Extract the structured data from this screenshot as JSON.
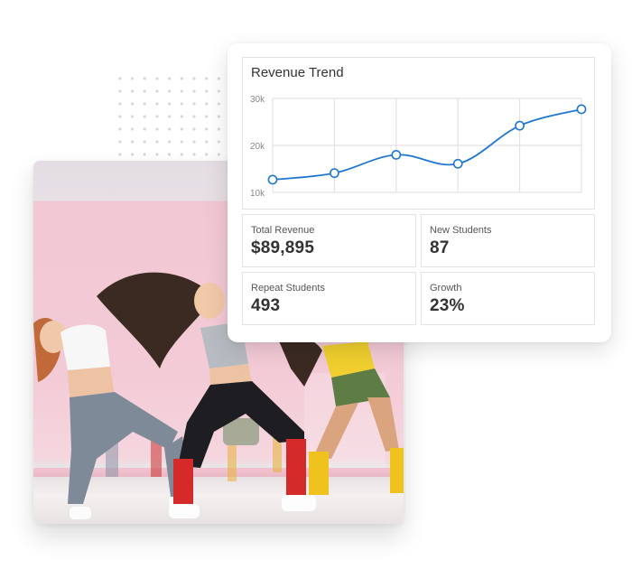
{
  "dashboard": {
    "chart_title": "Revenue Trend",
    "stats": [
      {
        "label": "Total Revenue",
        "value": "$89,895"
      },
      {
        "label": "New Students",
        "value": "87"
      },
      {
        "label": "Repeat Students",
        "value": "493"
      },
      {
        "label": "Growth",
        "value": "23%"
      }
    ]
  },
  "colors": {
    "line": "#1f77d0",
    "grid": "#e2e2e2",
    "axis_text": "#888888",
    "photo_wall": "#f2c6d3"
  },
  "photo": {
    "subject": "women dancing in a pink studio"
  },
  "chart_data": {
    "type": "line",
    "title": "Revenue Trend",
    "xlabel": "",
    "ylabel": "",
    "x": [
      1,
      2,
      3,
      4,
      5,
      6
    ],
    "categories": [
      "",
      "",
      "",
      "",
      "",
      ""
    ],
    "series": [
      {
        "name": "Revenue",
        "values": [
          12700,
          14100,
          18000,
          16100,
          24200,
          27700
        ]
      }
    ],
    "ylim": [
      10000,
      30000
    ],
    "yticks": [
      10000,
      20000,
      30000
    ],
    "ytick_labels": [
      "10k",
      "20k",
      "30k"
    ],
    "grid": true,
    "smooth": true,
    "markers": "hollow-circle",
    "legend": "none"
  }
}
